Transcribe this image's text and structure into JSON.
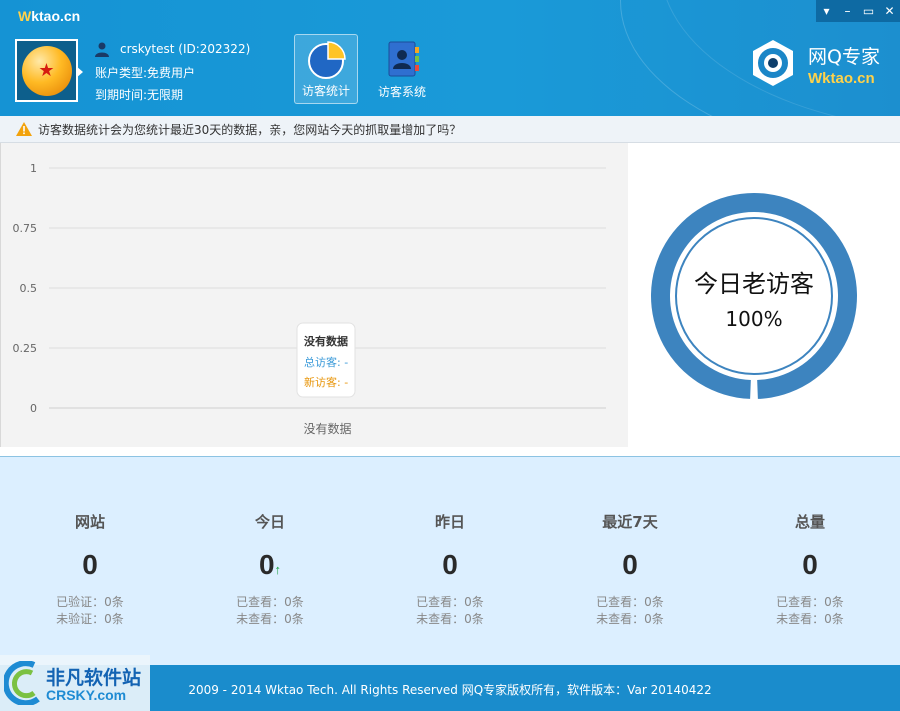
{
  "header": {
    "title_prefix": "W",
    "title_rest": "ktao.cn",
    "window_controls": [
      "▾",
      "–",
      "▭",
      "✕"
    ],
    "user": {
      "name": "crskytest (ID:202322)",
      "account_type": "账户类型:免费用户",
      "expiry": "到期时间:无限期"
    },
    "tools": [
      {
        "label": "访客统计",
        "active": true
      },
      {
        "label": "访客系统",
        "active": false
      }
    ],
    "brand": {
      "name": "网Q专家",
      "url": "Wktao.cn"
    }
  },
  "notice": {
    "text": "访客数据统计会为您统计最近30天的数据，亲，您网站今天的抓取量增加了吗？"
  },
  "chart_data": {
    "type": "line",
    "title": "",
    "xlabel": "没有数据",
    "ylabel": "",
    "y_ticks": [
      "1",
      "0.75",
      "0.5",
      "0.25",
      "0"
    ],
    "ylim": [
      0,
      1
    ],
    "grid": true,
    "series": [],
    "tooltip": {
      "title": "没有数据",
      "total": "总访客: -",
      "new": "新访客: -"
    },
    "colors": {
      "total": "#3a9ad9",
      "new": "#e8960c"
    }
  },
  "donut": {
    "label": "今日老访客",
    "percent": "100%",
    "value": 1.0,
    "color": "#3d84bf"
  },
  "stats": [
    {
      "name": "网站",
      "value": "0",
      "line1": "已验证：0条",
      "line2": "未验证：0条",
      "trend": ""
    },
    {
      "name": "今日",
      "value": "0",
      "line1": "已查看：0条",
      "line2": "未查看：0条",
      "trend": "↑"
    },
    {
      "name": "昨日",
      "value": "0",
      "line1": "已查看：0条",
      "line2": "未查看：0条",
      "trend": ""
    },
    {
      "name": "最近7天",
      "value": "0",
      "line1": "已查看：0条",
      "line2": "未查看：0条",
      "trend": ""
    },
    {
      "name": "总量",
      "value": "0",
      "line1": "已查看：0条",
      "line2": "未查看：0条",
      "trend": ""
    }
  ],
  "footer": {
    "copyright": "2009 - 2014 Wktao Tech. All Rights Reserved 网Q专家版权所有，软件版本：Var 20140422"
  },
  "watermark": {
    "name": "非凡软件站",
    "url": "CRSKY.com"
  }
}
